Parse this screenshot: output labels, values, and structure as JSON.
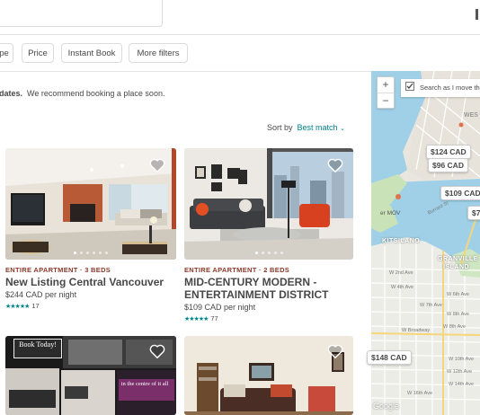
{
  "header": {
    "search_value": ""
  },
  "filters": [
    {
      "label": "pe"
    },
    {
      "label": "Price"
    },
    {
      "label": "Instant Book"
    },
    {
      "label": "More filters"
    }
  ],
  "notice": {
    "bold": "dates.",
    "text": "We recommend booking a place soon."
  },
  "sort": {
    "label": "Sort by",
    "value": "Best match"
  },
  "listings": [
    {
      "kind": "ENTIRE APARTMENT · 3 BEDS",
      "title": "New Listing Central Vancouver",
      "price": "$244 CAD",
      "per": "per night",
      "stars": "★★★★★",
      "reviews": "17"
    },
    {
      "kind": "ENTIRE APARTMENT · 2 BEDS",
      "title": "MID-CENTURY MODERN - ENTERTAINMENT DISTRICT",
      "price": "$109 CAD",
      "per": "per night",
      "stars": "★★★★★",
      "reviews": "77"
    },
    {
      "sign1": "Book Today!",
      "sign2": "in the centre of it all"
    },
    {}
  ],
  "map": {
    "zoom_in": "+",
    "zoom_out": "−",
    "search_move": "Search as I move th",
    "pins": [
      "$124 CAD",
      "$96 CAD",
      "$109 CAD",
      "$7",
      "$148 CAD"
    ],
    "labels": {
      "west": "WES",
      "kitsilano": "KITSILANO",
      "granville1": "GRANVILLE",
      "granville2": "ISLAND",
      "mov": "er MOV",
      "w2": "W 2nd Ave",
      "w4": "W 4th Ave",
      "w6": "W 6th Ave",
      "w7": "W 7th Ave",
      "w8": "W 8th Ave",
      "w10": "W 10th Ave",
      "w12": "W 12th Ave",
      "w14": "W 14th Ave",
      "w16": "W 16th Ave",
      "broadway": "W Broadway",
      "burrard": "Burrard St",
      "google": "Google"
    }
  },
  "colors": {
    "accent": "#008489",
    "kind": "#8a3a2a"
  }
}
